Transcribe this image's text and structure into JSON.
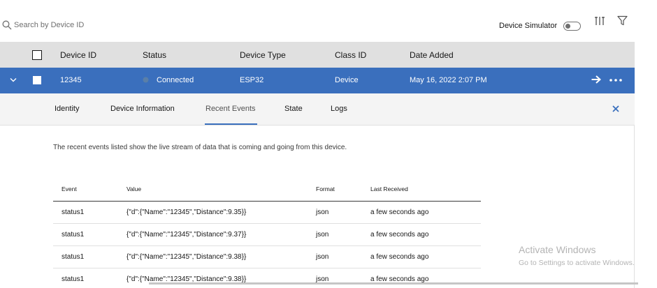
{
  "toolbar": {
    "search_placeholder": "Search by Device ID",
    "simulator_label": "Device Simulator",
    "simulator_on": false
  },
  "table": {
    "headers": [
      "Device ID",
      "Status",
      "Device Type",
      "Class ID",
      "Date Added"
    ],
    "rows": [
      {
        "device_id": "12345",
        "status": "Connected",
        "device_type": "ESP32",
        "class_id": "Device",
        "date_added": "May 16, 2022 2:07 PM"
      }
    ]
  },
  "detail": {
    "tabs": [
      "Identity",
      "Device Information",
      "Recent Events",
      "State",
      "Logs"
    ],
    "active_tab": "Recent Events",
    "description": "The recent events listed show the live stream of data that is coming and going from this device.",
    "events": {
      "headers": [
        "Event",
        "Value",
        "Format",
        "Last Received"
      ],
      "rows": [
        {
          "event": "status1",
          "value": "{\"d\":{\"Name\":\"12345\",\"Distance\":9.35}}",
          "format": "json",
          "last_received": "a few seconds ago"
        },
        {
          "event": "status1",
          "value": "{\"d\":{\"Name\":\"12345\",\"Distance\":9.37}}",
          "format": "json",
          "last_received": "a few seconds ago"
        },
        {
          "event": "status1",
          "value": "{\"d\":{\"Name\":\"12345\",\"Distance\":9.38}}",
          "format": "json",
          "last_received": "a few seconds ago"
        },
        {
          "event": "status1",
          "value": "{\"d\":{\"Name\":\"12345\",\"Distance\":9.38}}",
          "format": "json",
          "last_received": "a few seconds ago"
        }
      ]
    }
  },
  "watermark": {
    "line1": "Activate Windows",
    "line2": "Go to Settings to activate Windows."
  },
  "colors": {
    "selected_row": "#3a6fbd",
    "header_bg": "#e0e0e0",
    "tabs_bg": "#f4f4f4"
  }
}
